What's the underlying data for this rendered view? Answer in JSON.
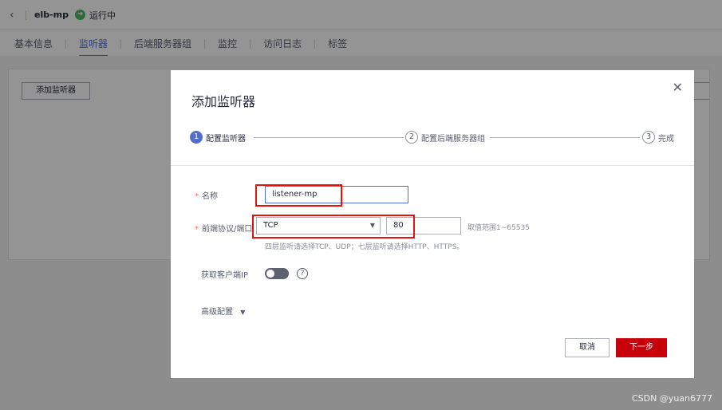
{
  "header": {
    "back_icon": "chevron-left-icon",
    "title": "elb-mp",
    "status_icon": "running-arrow-icon",
    "status_text": "运行中"
  },
  "tabs": [
    {
      "label": "基本信息",
      "active": false
    },
    {
      "label": "监听器",
      "active": true
    },
    {
      "label": "后端服务器组",
      "active": false
    },
    {
      "label": "监控",
      "active": false
    },
    {
      "label": "访问日志",
      "active": false
    },
    {
      "label": "标签",
      "active": false
    }
  ],
  "page": {
    "add_button": "添加监听器"
  },
  "dialog": {
    "title": "添加监听器",
    "close_icon": "close-icon",
    "steps": [
      {
        "num": "1",
        "label": "配置监听器",
        "active": true
      },
      {
        "num": "2",
        "label": "配置后端服务器组",
        "active": false
      },
      {
        "num": "3",
        "label": "完成",
        "active": false
      }
    ],
    "form": {
      "name_label": "名称",
      "name_value": "listener-mp",
      "protocol_label": "前端协议/端口",
      "protocol_value": "TCP",
      "port_value": "80",
      "port_range_hint": "取值范围1~65535",
      "protocol_hint": "四层监听请选择TCP、UDP；七层监听请选择HTTP、HTTPS。",
      "client_ip_label": "获取客户端IP",
      "client_ip_enabled": false,
      "advanced_label": "高级配置"
    },
    "buttons": {
      "cancel": "取消",
      "next": "下一步"
    }
  },
  "colors": {
    "accent": "#526ecc",
    "primary_button": "#c7000b",
    "highlight_box": "#e4140c",
    "status_green": "#50b366"
  },
  "watermark": "CSDN @yuan6777"
}
